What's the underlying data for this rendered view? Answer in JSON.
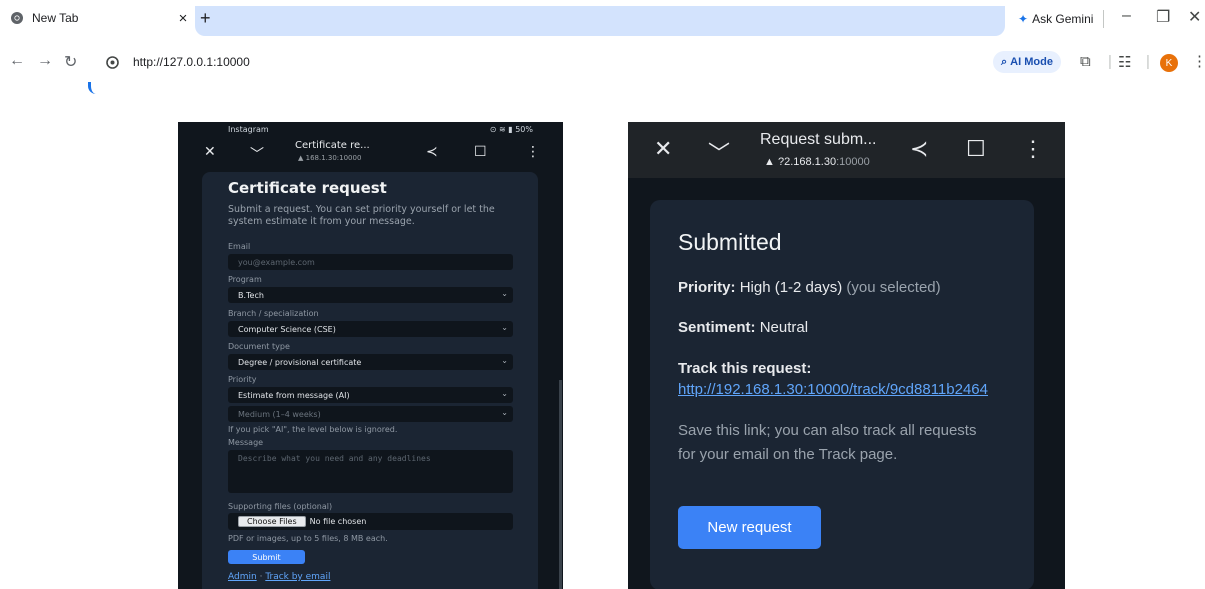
{
  "browser": {
    "tab_title": "New Tab",
    "tab_close": "×",
    "new_tab": "+",
    "ask_gemini": "Ask Gemini",
    "url": "http://127.0.0.1:10000",
    "ai_mode": "AI Mode",
    "profile_initial": "K"
  },
  "left_phone": {
    "status_app": "Instagram",
    "status_right": "50%",
    "tab_title": "Certificate re...",
    "host": "168.1.30:10000",
    "heading": "Certificate request",
    "subtitle": "Submit a request. You can set priority yourself or let the system estimate it from your message.",
    "email_label": "Email",
    "email_placeholder": "you@example.com",
    "program_label": "Program",
    "program_value": "B.Tech",
    "branch_label": "Branch / specialization",
    "branch_value": "Computer Science (CSE)",
    "doc_label": "Document type",
    "doc_value": "Degree / provisional certificate",
    "priority_label": "Priority",
    "priority_value": "Estimate from message (AI)",
    "level_value": "Medium (1–4 weeks)",
    "ai_hint": "If you pick \"AI\", the level below is ignored.",
    "message_label": "Message",
    "message_placeholder": "Describe what you need and any deadlines",
    "files_label": "Supporting files (optional)",
    "choose_files": "Choose Files",
    "no_file": "No file chosen",
    "files_hint": "PDF or images, up to 5 files, 8 MB each.",
    "submit": "Submit",
    "admin_link": "Admin",
    "separator": "·",
    "track_link": "Track by email"
  },
  "right_phone": {
    "tab_title": "Request subm...",
    "host_visible": "?2.168.1.30",
    "host_port": ":10000",
    "heading": "Submitted",
    "priority_label": "Priority:",
    "priority_value": "High (1-2 days)",
    "priority_note": "(you selected)",
    "sentiment_label": "Sentiment:",
    "sentiment_value": "Neutral",
    "track_label": "Track this request:",
    "track_url": "http://192.168.1.30:10000/track/9cd8811b2464",
    "save_note": "Save this link; you can also track all requests for your email on the Track page.",
    "new_request": "New request"
  }
}
